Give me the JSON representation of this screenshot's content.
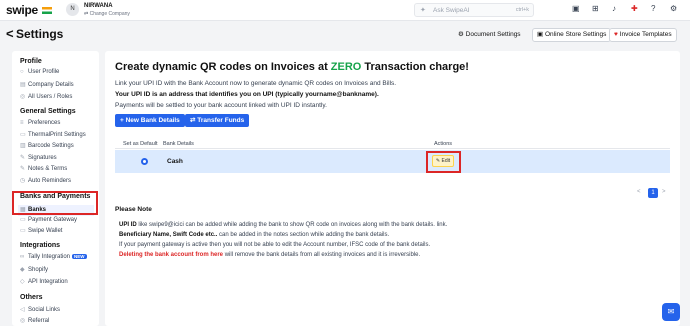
{
  "topbar": {
    "logo": "swipe",
    "avatar_initial": "N",
    "company_name": "NIRWANA",
    "change_company": "Change Company",
    "search_icon": "sparkle-icon",
    "search_placeholder": "Ask SwipeAI",
    "search_shortcut": "ctrl+k",
    "icons": [
      "shop-icon",
      "apps-icon",
      "bell-icon",
      "gift-icon",
      "help-icon",
      "gear-icon"
    ]
  },
  "header": {
    "back": "<",
    "title": "Settings",
    "document_settings": "Document Settings",
    "online_store_settings": "Online Store Settings",
    "invoice_templates": "Invoice Templates"
  },
  "sidebar": {
    "profile_heading": "Profile",
    "profile_items": [
      "User Profile",
      "Company Details",
      "All Users / Roles"
    ],
    "general_heading": "General Settings",
    "general_items": [
      "Preferences",
      "ThermalPrint Settings",
      "Barcode Settings",
      "Signatures",
      "Notes & Terms",
      "Auto Reminders"
    ],
    "banks_heading": "Banks and Payments",
    "banks_items": [
      "Banks",
      "Payment Gateway",
      "Swipe Wallet"
    ],
    "integrations_heading": "Integrations",
    "integration_items": [
      "Tally Integration",
      "Shopify",
      "API Integration"
    ],
    "new_badge": "NEW",
    "others_heading": "Others",
    "others_items": [
      "Social Links",
      "Referral"
    ]
  },
  "main": {
    "title_prefix": "Create dynamic QR codes on Invoices at ",
    "title_highlight": "ZERO",
    "title_suffix": " Transaction charge!",
    "line1": "Link your UPI ID with the Bank Account now to generate dynamic QR codes on Invoices and Bills.",
    "line2": "Your UPI ID is an address that identifies you on UPI (typically yourname@bankname).",
    "line3": "Payments will be settled to your bank account linked with UPI ID instantly.",
    "new_bank_button": "+ New Bank Details",
    "transfer_button": "Transfer Funds",
    "table": {
      "headers": [
        "Set as Default",
        "Bank Details",
        "Actions"
      ],
      "rows": [
        {
          "bank": "Cash",
          "action": "Edit"
        }
      ]
    },
    "pagination": {
      "prev": "<",
      "current": "1",
      "next": ">"
    },
    "note_title": "Please Note",
    "note1_bold": "UPI ID",
    "note1": " like swipe9@icici can be added while adding the bank to show QR code on invoices along with the bank details. link.",
    "note2_bold": "Beneficiary Name, Swift Code etc..",
    "note2": " can be added in the notes section while adding the bank details.",
    "note3": "If your payment gateway is active then you will not be able to edit the Account number, IFSC code of the bank details.",
    "note4_red": "Deleting the bank account from here",
    "note4": " will remove the bank details from all existing invoices and it is irreversible."
  },
  "colors": {
    "accent": "#2563eb",
    "highlight_red": "#dc2626",
    "zero_green": "#16a34a",
    "row_selected": "#dbeafe"
  }
}
